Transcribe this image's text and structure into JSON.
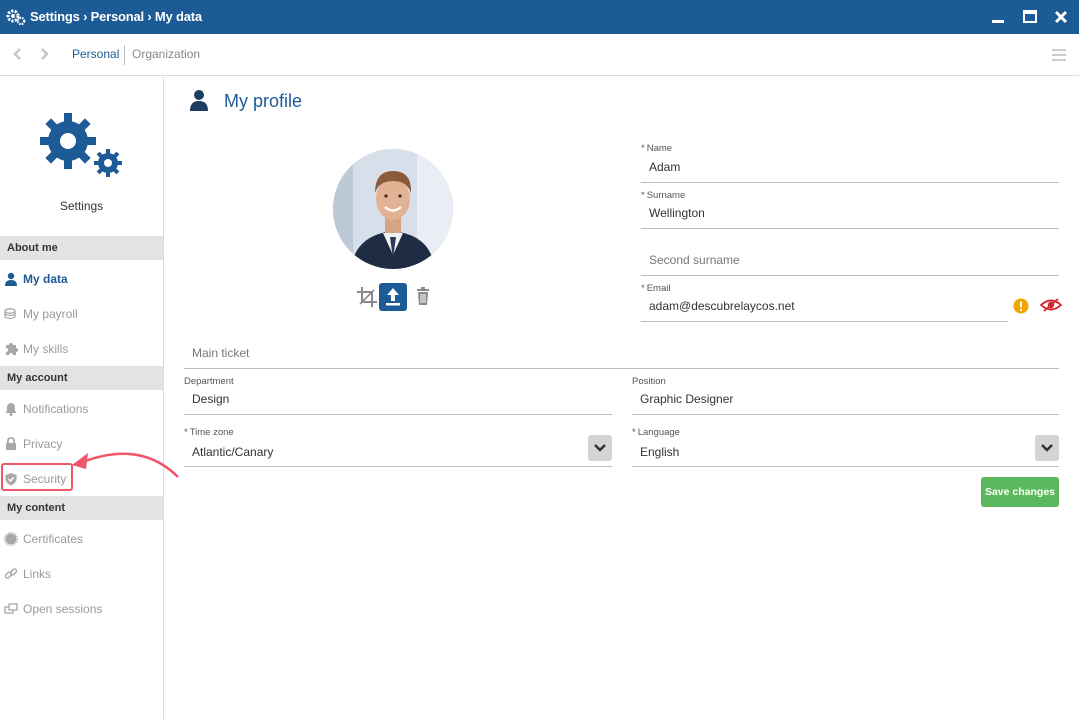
{
  "window": {
    "title": "Settings › Personal › My data",
    "icons": [
      "settings-gears-icon",
      "minimize-icon",
      "maximize-icon",
      "close-icon"
    ]
  },
  "toolbar": {
    "tabs": [
      {
        "label": "Personal",
        "active": true
      },
      {
        "label": "Organization",
        "active": false
      }
    ]
  },
  "sidebar": {
    "app_label": "Settings",
    "sections": [
      {
        "title": "About me",
        "items": [
          {
            "label": "My data",
            "icon": "user-icon",
            "active": true
          },
          {
            "label": "My payroll",
            "icon": "coins-icon"
          },
          {
            "label": "My skills",
            "icon": "puzzle-icon"
          }
        ]
      },
      {
        "title": "My account",
        "items": [
          {
            "label": "Notifications",
            "icon": "bell-icon"
          },
          {
            "label": "Privacy",
            "icon": "lock-icon"
          },
          {
            "label": "Security",
            "icon": "shield-icon"
          }
        ]
      },
      {
        "title": "My content",
        "items": [
          {
            "label": "Certificates",
            "icon": "certificate-icon"
          },
          {
            "label": "Links",
            "icon": "link-icon"
          },
          {
            "label": "Open sessions",
            "icon": "sessions-icon"
          }
        ]
      }
    ]
  },
  "main": {
    "title": "My profile",
    "fields": {
      "name": {
        "label": "Name",
        "required": "*",
        "value": "Adam"
      },
      "surname": {
        "label": "Surname",
        "required": "*",
        "value": "Wellington"
      },
      "second_surname": {
        "placeholder": "Second surname"
      },
      "email": {
        "label": "Email",
        "required": "*",
        "value": "adam@descubrelaycos.net"
      },
      "main_ticket": {
        "placeholder": "Main ticket"
      },
      "department": {
        "label": "Department",
        "value": "Design"
      },
      "position": {
        "label": "Position",
        "value": "Graphic Designer"
      },
      "time_zone": {
        "label": "Time zone",
        "required": "*",
        "value": "Atlantic/Canary"
      },
      "language": {
        "label": "Language",
        "required": "*",
        "value": "English"
      }
    },
    "save_label": "Save changes"
  },
  "colors": {
    "brand": "#1d5b96",
    "save": "#5cb85c",
    "highlight": "#f0576a",
    "warning": "#f0a500",
    "eye": "#d9232e"
  }
}
